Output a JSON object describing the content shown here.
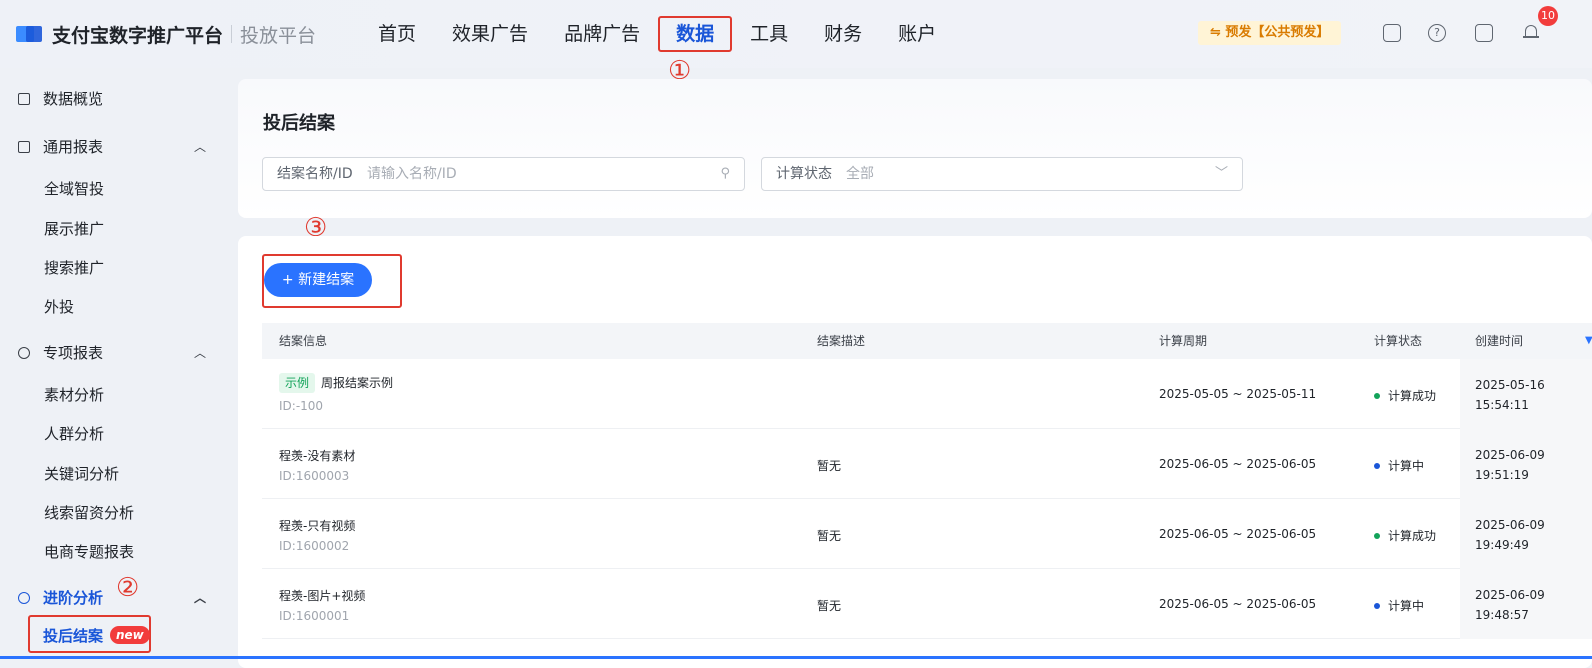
{
  "header": {
    "brand": "支付宝数字推广平台",
    "sub_brand": "投放平台",
    "nav": [
      "首页",
      "效果广告",
      "品牌广告",
      "数据",
      "工具",
      "财务",
      "账户"
    ],
    "active_nav_index": 3,
    "env_badge": "⇋ 预发【公共预发】",
    "notification_count": "10",
    "icons": [
      "tablet-icon",
      "help-icon",
      "task-icon",
      "bell-icon"
    ]
  },
  "annotations": {
    "one": "①",
    "two": "②",
    "three": "③"
  },
  "sidebar": {
    "overview": "数据概览",
    "groups": [
      {
        "label": "通用报表",
        "items": [
          "全域智投",
          "展示推广",
          "搜索推广",
          "外投"
        ]
      },
      {
        "label": "专项报表",
        "items": [
          "素材分析",
          "人群分析",
          "关键词分析",
          "线索留资分析",
          "电商专题报表"
        ]
      },
      {
        "label": "进阶分析",
        "items": [
          "投后结案"
        ]
      }
    ],
    "active_item": "投后结案",
    "new_badge": "new"
  },
  "filters": {
    "title": "投后结案",
    "name_label": "结案名称/ID",
    "name_placeholder": "请输入名称/ID",
    "status_label": "计算状态",
    "status_value": "全部"
  },
  "toolbar": {
    "new_button": "+ 新建结案"
  },
  "table": {
    "columns": [
      "结案信息",
      "结案描述",
      "计算周期",
      "计算状态",
      "创建时间"
    ],
    "rows": [
      {
        "tag": "示例",
        "name": "周报结案示例",
        "id": "ID:-100",
        "desc": "",
        "period": "2025-05-05 ~ 2025-05-11",
        "status": "计算成功",
        "status_color": "#13a35a",
        "created_date": "2025-05-16",
        "created_time": "15:54:11"
      },
      {
        "tag": "",
        "name": "程羡-没有素材",
        "id": "ID:1600003",
        "desc": "暂无",
        "period": "2025-06-05 ~ 2025-06-05",
        "status": "计算中",
        "status_color": "#1a56d8",
        "created_date": "2025-06-09",
        "created_time": "19:51:19"
      },
      {
        "tag": "",
        "name": "程羡-只有视频",
        "id": "ID:1600002",
        "desc": "暂无",
        "period": "2025-06-05 ~ 2025-06-05",
        "status": "计算成功",
        "status_color": "#13a35a",
        "created_date": "2025-06-09",
        "created_time": "19:49:49"
      },
      {
        "tag": "",
        "name": "程羡-图片+视频",
        "id": "ID:1600001",
        "desc": "暂无",
        "period": "2025-06-05 ~ 2025-06-05",
        "status": "计算中",
        "status_color": "#1a56d8",
        "created_date": "2025-06-09",
        "created_time": "19:48:57"
      }
    ]
  }
}
